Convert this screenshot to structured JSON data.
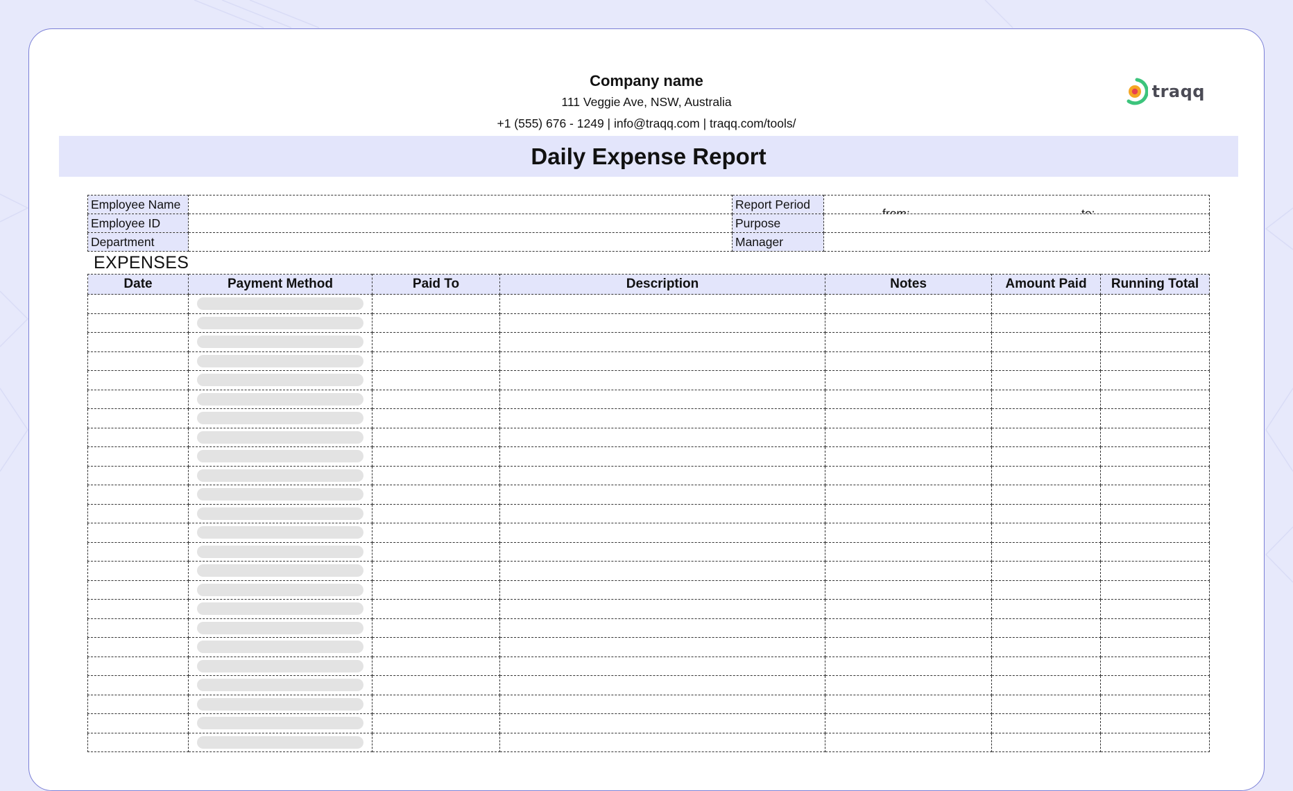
{
  "company": {
    "name": "Company name",
    "address": "111 Veggie Ave, NSW, Australia",
    "contact": "+1 (555) 676 - 1249 | info@traqq.com | traqq.com/tools/"
  },
  "logo": {
    "text": "traqq",
    "icon": "traqq-logo-icon"
  },
  "report": {
    "title": "Daily Expense Report"
  },
  "info": {
    "employee_name_label": "Employee Name",
    "employee_id_label": "Employee ID",
    "department_label": "Department",
    "report_period_label": "Report Period",
    "from_label": "from:",
    "to_label": "to:",
    "purpose_label": "Purpose",
    "manager_label": "Manager"
  },
  "expenses": {
    "section_title": "EXPENSES",
    "columns": [
      "Date",
      "Payment Method",
      "Paid To",
      "Description",
      "Notes",
      "Amount Paid",
      "Running Total"
    ],
    "row_count": 24
  },
  "colors": {
    "page_background": "#e7e9fb",
    "band": "#e3e5fb",
    "border_accent": "#7b7fd6",
    "logo_green": "#3cc47c",
    "logo_orange": "#f5a623",
    "logo_red": "#e8414f"
  }
}
